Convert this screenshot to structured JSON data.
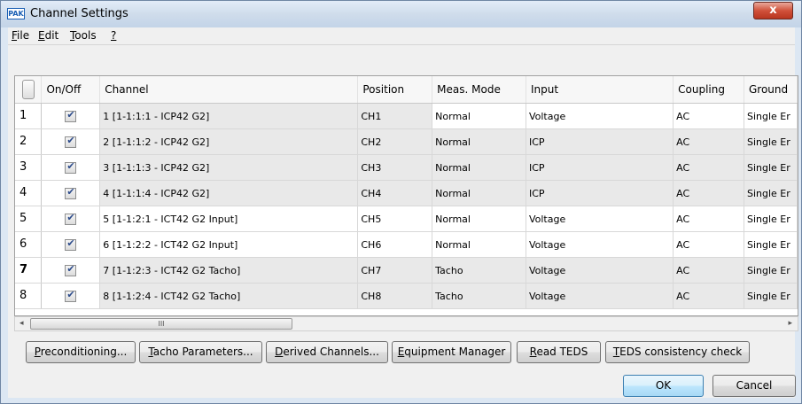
{
  "window": {
    "title": "Channel Settings",
    "app_icon_text": "PAK",
    "close_glyph": "x"
  },
  "menu": [
    {
      "label": "File",
      "mnemonic": "F",
      "rest": "ile"
    },
    {
      "label": "Edit",
      "mnemonic": "E",
      "rest": "dit"
    },
    {
      "label": "Tools",
      "mnemonic": "T",
      "rest": "ools"
    },
    {
      "label": "?",
      "mnemonic": "?",
      "rest": ""
    }
  ],
  "table": {
    "columns": [
      "",
      "On/Off",
      "Channel",
      "Position",
      "Meas. Mode",
      "Input",
      "Coupling",
      "Ground"
    ],
    "rows": [
      {
        "num": "1",
        "checked": true,
        "channel": "1 [1-1:1:1 - ICP42 G2]",
        "position": "CH1",
        "mode": "Normal",
        "input": "Voltage",
        "coupling": "AC",
        "ground": "Single Er"
      },
      {
        "num": "2",
        "checked": true,
        "channel": "2 [1-1:1:2 - ICP42 G2]",
        "position": "CH2",
        "mode": "Normal",
        "input": "ICP",
        "coupling": "AC",
        "ground": "Single Er"
      },
      {
        "num": "3",
        "checked": true,
        "channel": "3 [1-1:1:3 - ICP42 G2]",
        "position": "CH3",
        "mode": "Normal",
        "input": "ICP",
        "coupling": "AC",
        "ground": "Single Er"
      },
      {
        "num": "4",
        "checked": true,
        "channel": "4 [1-1:1:4 - ICP42 G2]",
        "position": "CH4",
        "mode": "Normal",
        "input": "ICP",
        "coupling": "AC",
        "ground": "Single Er"
      },
      {
        "num": "5",
        "checked": true,
        "channel": "5 [1-1:2:1 - ICT42 G2 Input]",
        "position": "CH5",
        "mode": "Normal",
        "input": "Voltage",
        "coupling": "AC",
        "ground": "Single Er"
      },
      {
        "num": "6",
        "checked": true,
        "channel": "6 [1-1:2:2 - ICT42 G2 Input]",
        "position": "CH6",
        "mode": "Normal",
        "input": "Voltage",
        "coupling": "AC",
        "ground": "Single Er"
      },
      {
        "num": "7",
        "checked": true,
        "channel": "7 [1-1:2:3 - ICT42 G2 Tacho]",
        "position": "CH7",
        "mode": "Tacho",
        "input": "Voltage",
        "coupling": "AC",
        "ground": "Single Er"
      },
      {
        "num": "8",
        "checked": true,
        "channel": "8 [1-1:2:4 - ICT42 G2 Tacho]",
        "position": "CH8",
        "mode": "Tacho",
        "input": "Voltage",
        "coupling": "AC",
        "ground": "Single Er"
      }
    ]
  },
  "scrollbar": {
    "left_arrow": "◂",
    "right_arrow": "▸",
    "thumb_grip": "III"
  },
  "buttons": {
    "preconditioning": {
      "mn": "P",
      "rest": "reconditioning..."
    },
    "tacho": {
      "mn": "T",
      "rest": "acho Parameters..."
    },
    "derived": {
      "mn": "D",
      "rest": "erived Channels..."
    },
    "equipment": {
      "mn": "E",
      "rest": "quipment Manager"
    },
    "read_teds": {
      "mn": "R",
      "rest": "ead TEDS"
    },
    "teds_check": {
      "mn": "T",
      "rest": "EDS consistency check"
    },
    "ok": "OK",
    "cancel": "Cancel"
  }
}
